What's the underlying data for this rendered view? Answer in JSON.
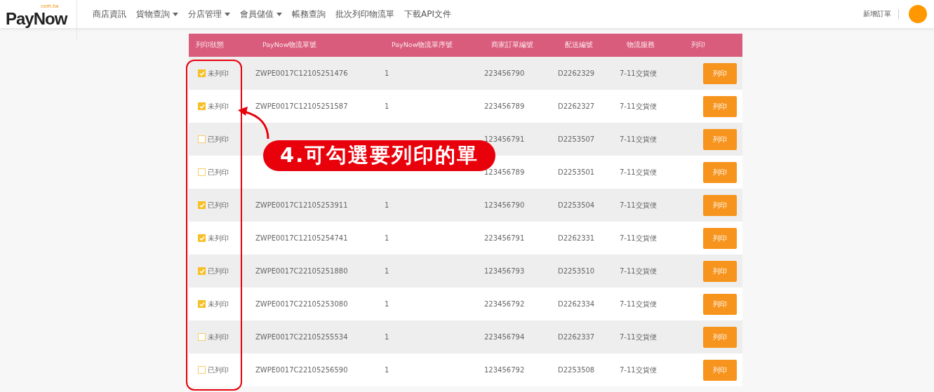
{
  "header": {
    "logo": {
      "name": "PayNow",
      "domain": "com.tw"
    },
    "nav": [
      {
        "label": "商店資訊",
        "dropdown": false
      },
      {
        "label": "貨物查詢",
        "dropdown": true
      },
      {
        "label": "分店管理",
        "dropdown": true
      },
      {
        "label": "會員儲值",
        "dropdown": true
      },
      {
        "label": "帳務查詢",
        "dropdown": false
      },
      {
        "label": "批次列印物流單",
        "dropdown": false
      },
      {
        "label": "下載API文件",
        "dropdown": false
      }
    ],
    "new_order": "新增訂單"
  },
  "table": {
    "columns": [
      "列印狀態",
      "PayNow物流單號",
      "PayNow物流單序號",
      "商家訂單編號",
      "配送編號",
      "物流服務",
      "列印"
    ],
    "rows": [
      {
        "checked": true,
        "status": "未列印",
        "tracking": "ZWPE0017C12105251476",
        "seq": "1",
        "order": "223456790",
        "delivery": "D2262329",
        "service": "7-11交貨便",
        "button": "列印"
      },
      {
        "checked": true,
        "status": "未列印",
        "tracking": "ZWPE0017C12105251587",
        "seq": "1",
        "order": "223456789",
        "delivery": "D2262327",
        "service": "7-11交貨便",
        "button": "列印"
      },
      {
        "checked": false,
        "status": "已列印",
        "order": "123456791",
        "delivery": "D2253507",
        "service": "7-11交貨便",
        "button": "列印"
      },
      {
        "checked": false,
        "status": "已列印",
        "order": "123456789",
        "delivery": "D2253501",
        "service": "7-11交貨便",
        "button": "列印"
      },
      {
        "checked": true,
        "status": "已列印",
        "tracking": "ZWPE0017C12105253911",
        "seq": "1",
        "order": "123456790",
        "delivery": "D2253504",
        "service": "7-11交貨便",
        "button": "列印"
      },
      {
        "checked": true,
        "status": "未列印",
        "tracking": "ZWPE0017C12105254741",
        "seq": "1",
        "order": "223456791",
        "delivery": "D2262331",
        "service": "7-11交貨便",
        "button": "列印"
      },
      {
        "checked": true,
        "status": "已列印",
        "tracking": "ZWPE0017C22105251880",
        "seq": "1",
        "order": "123456793",
        "delivery": "D2253510",
        "service": "7-11交貨便",
        "button": "列印"
      },
      {
        "checked": true,
        "status": "未列印",
        "tracking": "ZWPE0017C22105253080",
        "seq": "1",
        "order": "223456792",
        "delivery": "D2262334",
        "service": "7-11交貨便",
        "button": "列印"
      },
      {
        "checked": false,
        "status": "未列印",
        "tracking": "ZWPE0017C22105255534",
        "seq": "1",
        "order": "223456794",
        "delivery": "D2262337",
        "service": "7-11交貨便",
        "button": "列印"
      },
      {
        "checked": false,
        "status": "已列印",
        "tracking": "ZWPE0017C22105256590",
        "seq": "1",
        "order": "123456792",
        "delivery": "D2253508",
        "service": "7-11交貨便",
        "button": "列印"
      }
    ]
  },
  "annotation": {
    "callout": "4.可勾選要列印的單"
  }
}
